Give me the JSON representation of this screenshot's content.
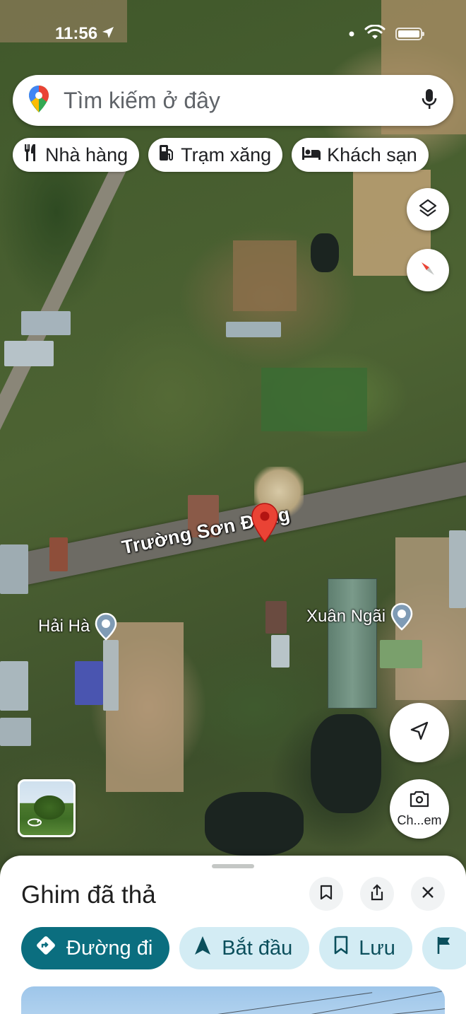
{
  "status_bar": {
    "time": "11:56"
  },
  "search": {
    "placeholder": "Tìm kiếm ở đây",
    "logo_icon": "google-maps-pin-icon",
    "mic_icon": "microphone-icon"
  },
  "chips": [
    {
      "label": "Nhà hàng",
      "icon": "restaurant-icon"
    },
    {
      "label": "Trạm xăng",
      "icon": "gas-station-icon"
    },
    {
      "label": "Khách sạn",
      "icon": "hotel-bed-icon"
    }
  ],
  "map": {
    "road_name": "Trường Sơn Đông",
    "places": [
      {
        "name": "Hải Hà"
      },
      {
        "name": "Xuân Ngãi"
      }
    ],
    "pin_color": "#EA4335"
  },
  "map_buttons": {
    "layers_icon": "layers-icon",
    "compass_icon": "compass-icon",
    "my_location_icon": "navigation-arrow-icon",
    "camera_label": "Ch...em",
    "camera_icon": "camera-search-icon"
  },
  "sheet": {
    "title": "Ghim đã thả",
    "actions": [
      {
        "label": "Đường đi",
        "icon": "directions-icon"
      },
      {
        "label": "Bắt đầu",
        "icon": "navigation-start-icon"
      },
      {
        "label": "Lưu",
        "icon": "bookmark-icon"
      }
    ]
  },
  "colors": {
    "primary_action": "#0B6E7F",
    "secondary_action_bg": "#D3ECF4",
    "secondary_action_text": "#0B4F5C"
  }
}
